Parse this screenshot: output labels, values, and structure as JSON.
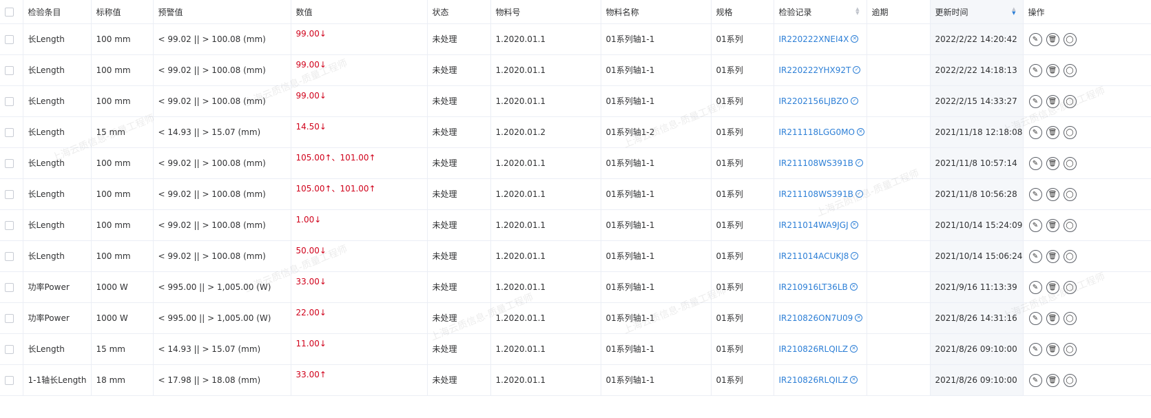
{
  "columns": [
    "检验条目",
    "标称值",
    "预警值",
    "数值",
    "状态",
    "物料号",
    "物料名称",
    "规格",
    "检验记录",
    "逾期",
    "更新时间",
    "操作"
  ],
  "sort": {
    "asc": "▲",
    "desc": "▼"
  },
  "watermark": "上海云质信息-质量工程师",
  "rows": [
    {
      "item": "长Length",
      "nominal": "100 mm",
      "warning": "< 99.02 || > 100.08 (mm)",
      "value": "99.00↓",
      "status": "未处理",
      "material_no": "1.2020.01.1",
      "material_name": "01系列轴1-1",
      "spec": "01系列",
      "record": "IR220222XNEI4X",
      "record_icon": "x-circle-icon",
      "record_mark": "✕",
      "overdue": "",
      "updated": "2022/2/22 14:20:42"
    },
    {
      "item": "长Length",
      "nominal": "100 mm",
      "warning": "< 99.02 || > 100.08 (mm)",
      "value": "99.00↓",
      "status": "未处理",
      "material_no": "1.2020.01.1",
      "material_name": "01系列轴1-1",
      "spec": "01系列",
      "record": "IR220222YHX92T",
      "record_icon": "check-circle-icon",
      "record_mark": "✓",
      "overdue": "",
      "updated": "2022/2/22 14:18:13"
    },
    {
      "item": "长Length",
      "nominal": "100 mm",
      "warning": "< 99.02 || > 100.08 (mm)",
      "value": "99.00↓",
      "status": "未处理",
      "material_no": "1.2020.01.1",
      "material_name": "01系列轴1-1",
      "spec": "01系列",
      "record": "IR2202156LJBZO",
      "record_icon": "check-circle-icon",
      "record_mark": "✓",
      "overdue": "",
      "updated": "2022/2/15 14:33:27"
    },
    {
      "item": "长Length",
      "nominal": "15 mm",
      "warning": "< 14.93 || > 15.07 (mm)",
      "value": "14.50↓",
      "status": "未处理",
      "material_no": "1.2020.01.2",
      "material_name": "01系列轴1-2",
      "spec": "01系列",
      "record": "IR211118LGG0MO",
      "record_icon": "x-circle-icon",
      "record_mark": "✕",
      "overdue": "",
      "updated": "2021/11/18 12:18:08"
    },
    {
      "item": "长Length",
      "nominal": "100 mm",
      "warning": "< 99.02 || > 100.08 (mm)",
      "value": "105.00↑、101.00↑",
      "status": "未处理",
      "material_no": "1.2020.01.1",
      "material_name": "01系列轴1-1",
      "spec": "01系列",
      "record": "IR211108WS391B",
      "record_icon": "check-circle-icon",
      "record_mark": "✓",
      "overdue": "",
      "updated": "2021/11/8 10:57:14"
    },
    {
      "item": "长Length",
      "nominal": "100 mm",
      "warning": "< 99.02 || > 100.08 (mm)",
      "value": "105.00↑、101.00↑",
      "status": "未处理",
      "material_no": "1.2020.01.1",
      "material_name": "01系列轴1-1",
      "spec": "01系列",
      "record": "IR211108WS391B",
      "record_icon": "check-circle-icon",
      "record_mark": "✓",
      "overdue": "",
      "updated": "2021/11/8 10:56:28"
    },
    {
      "item": "长Length",
      "nominal": "100 mm",
      "warning": "< 99.02 || > 100.08 (mm)",
      "value": "1.00↓",
      "status": "未处理",
      "material_no": "1.2020.01.1",
      "material_name": "01系列轴1-1",
      "spec": "01系列",
      "record": "IR211014WA9JGJ",
      "record_icon": "x-circle-icon",
      "record_mark": "✕",
      "overdue": "",
      "updated": "2021/10/14 15:24:09"
    },
    {
      "item": "长Length",
      "nominal": "100 mm",
      "warning": "< 99.02 || > 100.08 (mm)",
      "value": "50.00↓",
      "status": "未处理",
      "material_no": "1.2020.01.1",
      "material_name": "01系列轴1-1",
      "spec": "01系列",
      "record": "IR211014ACUKJ8",
      "record_icon": "check-circle-icon",
      "record_mark": "✓",
      "overdue": "",
      "updated": "2021/10/14 15:06:24"
    },
    {
      "item": "功率Power",
      "nominal": "1000 W",
      "warning": "< 995.00 || > 1,005.00 (W)",
      "value": "33.00↓",
      "status": "未处理",
      "material_no": "1.2020.01.1",
      "material_name": "01系列轴1-1",
      "spec": "01系列",
      "record": "IR210916LT36LB",
      "record_icon": "x-circle-icon",
      "record_mark": "✕",
      "overdue": "",
      "updated": "2021/9/16 11:13:39"
    },
    {
      "item": "功率Power",
      "nominal": "1000 W",
      "warning": "< 995.00 || > 1,005.00 (W)",
      "value": "22.00↓",
      "status": "未处理",
      "material_no": "1.2020.01.1",
      "material_name": "01系列轴1-1",
      "spec": "01系列",
      "record": "IR210826ON7U09",
      "record_icon": "x-circle-icon",
      "record_mark": "✕",
      "overdue": "",
      "updated": "2021/8/26 14:31:16"
    },
    {
      "item": "长Length",
      "nominal": "15 mm",
      "warning": "< 14.93 || > 15.07 (mm)",
      "value": "11.00↓",
      "status": "未处理",
      "material_no": "1.2020.01.1",
      "material_name": "01系列轴1-1",
      "spec": "01系列",
      "record": "IR210826RLQILZ",
      "record_icon": "x-circle-icon",
      "record_mark": "✕",
      "overdue": "",
      "updated": "2021/8/26 09:10:00"
    },
    {
      "item": "1-1轴长Length",
      "nominal": "18 mm",
      "warning": "< 17.98 || > 18.08 (mm)",
      "value": "33.00↑",
      "status": "未处理",
      "material_no": "1.2020.01.1",
      "material_name": "01系列轴1-1",
      "spec": "01系列",
      "record": "IR210826RLQILZ",
      "record_icon": "x-circle-icon",
      "record_mark": "✕",
      "overdue": "",
      "updated": "2021/8/26 09:10:00"
    }
  ],
  "actions": [
    {
      "name": "edit-icon",
      "glyph": "✎"
    },
    {
      "name": "delete-icon",
      "glyph": "🗑"
    },
    {
      "name": "more-icon",
      "glyph": "◯"
    }
  ]
}
